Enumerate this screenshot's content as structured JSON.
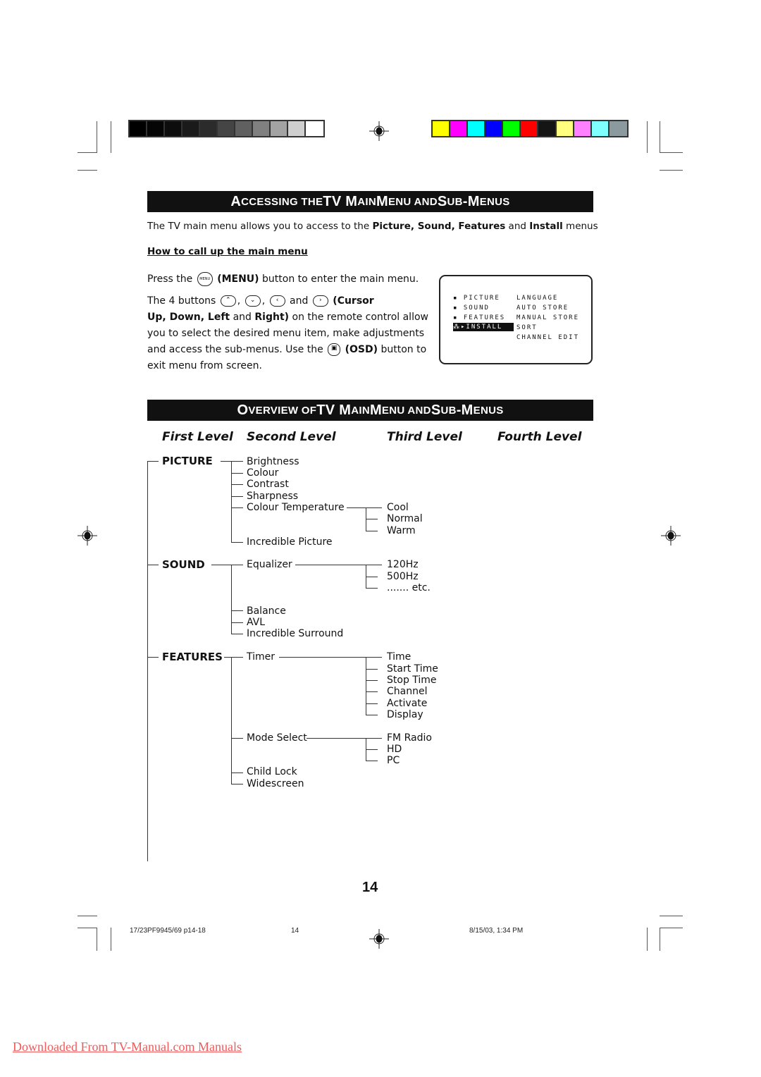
{
  "color_bars": {
    "grayscale": [
      "#000000",
      "#050505",
      "#0d0d0d",
      "#1a1a1a",
      "#2b2b2b",
      "#454545",
      "#606060",
      "#808080",
      "#a3a3a3",
      "#cfcfcf",
      "#ffffff"
    ],
    "colors": [
      "#ffff00",
      "#ff00ff",
      "#00ffff",
      "#0000ff",
      "#00ff00",
      "#ff0000",
      "#151515",
      "#ffff80",
      "#ff80ff",
      "#80ffff",
      "#8a9a9e"
    ]
  },
  "section1": {
    "title_parts": [
      {
        "t": "A",
        "big": true
      },
      {
        "t": "CCESSING THE ",
        "big": false
      },
      {
        "t": "TV M",
        "big": true
      },
      {
        "t": "AIN ",
        "big": false
      },
      {
        "t": "M",
        "big": true
      },
      {
        "t": "ENU AND ",
        "big": false
      },
      {
        "t": "S",
        "big": true
      },
      {
        "t": "UB",
        "big": false
      },
      {
        "t": "-M",
        "big": true
      },
      {
        "t": "ENUS",
        "big": false
      }
    ],
    "intro_pre": "The TV main menu allows you to access to the ",
    "intro_bold1": "Picture, Sound, Features",
    "intro_mid": " and ",
    "intro_bold2": "Install",
    "intro_post": " menus",
    "subheading": "How to call up the main menu",
    "press_pre": "Press the ",
    "menu_icon_label": "MENU",
    "press_bold": "(MENU)",
    "press_post": " button to enter the main menu.",
    "buttons_pre": "The 4 buttons ",
    "buttons_and": " and ",
    "buttons_bold1": "(Cursor",
    "buttons_bold2": "Up, Down, Left",
    "buttons_and2": " and ",
    "buttons_bold3": "Right)",
    "buttons_post": " on the remote control allow",
    "line3": "you to select the desired menu item, make adjustments",
    "line4_pre": "and access the sub-menus. Use the ",
    "osd_bold": "(OSD)",
    "line4_post": " button to",
    "line5": "exit menu from screen.",
    "icons": {
      "up": "⌃",
      "down": "⌄",
      "left": "‹",
      "right": "›",
      "osd": "▣"
    }
  },
  "osd_screen": {
    "left_items": [
      "▪ PICTURE",
      "▪ SOUND",
      "▪ FEATURES",
      "⁂▸INSTALL"
    ],
    "selected_index": 3,
    "right_items": [
      "LANGUAGE",
      "AUTO STORE",
      "MANUAL STORE",
      "SORT",
      "CHANNEL EDIT"
    ]
  },
  "section2": {
    "title_parts": [
      {
        "t": "O",
        "big": true
      },
      {
        "t": "VERVIEW OF ",
        "big": false
      },
      {
        "t": "TV M",
        "big": true
      },
      {
        "t": "AIN ",
        "big": false
      },
      {
        "t": "M",
        "big": true
      },
      {
        "t": "ENU AND ",
        "big": false
      },
      {
        "t": "S",
        "big": true
      },
      {
        "t": "UB",
        "big": false
      },
      {
        "t": "-M",
        "big": true
      },
      {
        "t": "ENUS",
        "big": false
      }
    ],
    "levels": [
      "First Level",
      "Second Level",
      "Third Level",
      "Fourth Level"
    ]
  },
  "tree": {
    "picture": {
      "label": "PICTURE",
      "items": [
        "Brightness",
        "Colour",
        "Contrast",
        "Sharpness",
        "Colour Temperature",
        "Incredible Picture"
      ],
      "colour_temperature": [
        "Cool",
        "Normal",
        "Warm"
      ]
    },
    "sound": {
      "label": "SOUND",
      "items": [
        "Equalizer",
        "Balance",
        "AVL",
        "Incredible Surround"
      ],
      "equalizer": [
        "120Hz",
        "500Hz",
        "....... etc."
      ]
    },
    "features": {
      "label": "FEATURES",
      "items": [
        "Timer",
        "Mode Select",
        "Child Lock",
        "Widescreen"
      ],
      "timer": [
        "Time",
        "Start Time",
        "Stop Time",
        "Channel",
        "Activate",
        "Display"
      ],
      "mode_select": [
        "FM Radio",
        "HD",
        "PC"
      ]
    }
  },
  "page_number": "14",
  "footer": {
    "file": "17/23PF9945/69 p14-18",
    "page": "14",
    "date": "8/15/03, 1:34 PM"
  },
  "download_link": "Downloaded From TV-Manual.com Manuals"
}
